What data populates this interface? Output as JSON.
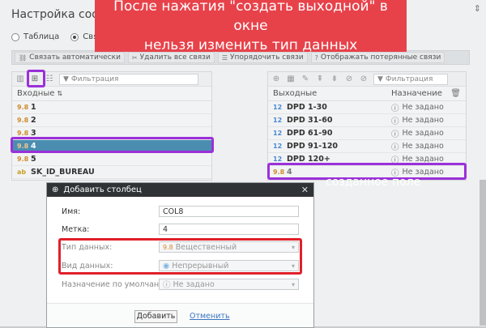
{
  "window": {
    "title": "Настройка соотв",
    "control": "⇕"
  },
  "view_options": [
    {
      "label": "Таблица",
      "selected": false
    },
    {
      "label": "Свя",
      "selected": true
    }
  ],
  "toolbar": [
    {
      "icon": "link-icon",
      "label": "Связать автоматически"
    },
    {
      "icon": "unlink-icon",
      "label": "Удалить все связи"
    },
    {
      "icon": "sort-icon",
      "label": "Упорядочить связи"
    },
    {
      "icon": "help-icon",
      "label": "Отображать потерянные связи"
    }
  ],
  "inputs_panel": {
    "filter_placeholder": "Фильтрация",
    "column": "Входные",
    "rows": [
      {
        "type": "9.8",
        "name": "1",
        "selected": false
      },
      {
        "type": "9.8",
        "name": "2",
        "selected": false
      },
      {
        "type": "9.8",
        "name": "3",
        "selected": false
      },
      {
        "type": "9.8",
        "name": "4",
        "selected": true
      },
      {
        "type": "9.8",
        "name": "5",
        "selected": false
      },
      {
        "type": "ab",
        "name": "SK_ID_BUREAU",
        "selected": false
      }
    ]
  },
  "outputs_panel": {
    "filter_placeholder": "Фильтрация",
    "col_output": "Выходные",
    "col_target": "Назначение",
    "rows": [
      {
        "type": "12",
        "name": "DPD 1-30",
        "target": "Не задано"
      },
      {
        "type": "12",
        "name": "DPD 31-60",
        "target": "Не задано"
      },
      {
        "type": "12",
        "name": "DPD 61-90",
        "target": "Не задано"
      },
      {
        "type": "12",
        "name": "DPD 91-120",
        "target": "Не задано"
      },
      {
        "type": "12",
        "name": "DPD 120+",
        "target": "Не задано"
      },
      {
        "type": "9.8",
        "name": "4",
        "target": "Не задано"
      }
    ]
  },
  "annotations": {
    "banner_line1": "После нажатия \"создать выходной\" в окне",
    "banner_line2": "нельзя изменить тип данных",
    "callout": "созданное поле",
    "colors": {
      "banner": "#e7424a",
      "highlight": "#9b30d9"
    }
  },
  "dialog": {
    "title": "Добавить столбец",
    "name_label": "Имя:",
    "name_value": "COL8",
    "mark_label": "Метка:",
    "mark_value": "4",
    "type_label": "Тип данных:",
    "type_value": "Вещественный",
    "kind_label": "Вид данных:",
    "kind_value": "Непрерывный",
    "default_label": "Назначение по умолчанию:",
    "default_value": "Не задано",
    "add_button": "Добавить",
    "cancel_button": "Отменить"
  }
}
